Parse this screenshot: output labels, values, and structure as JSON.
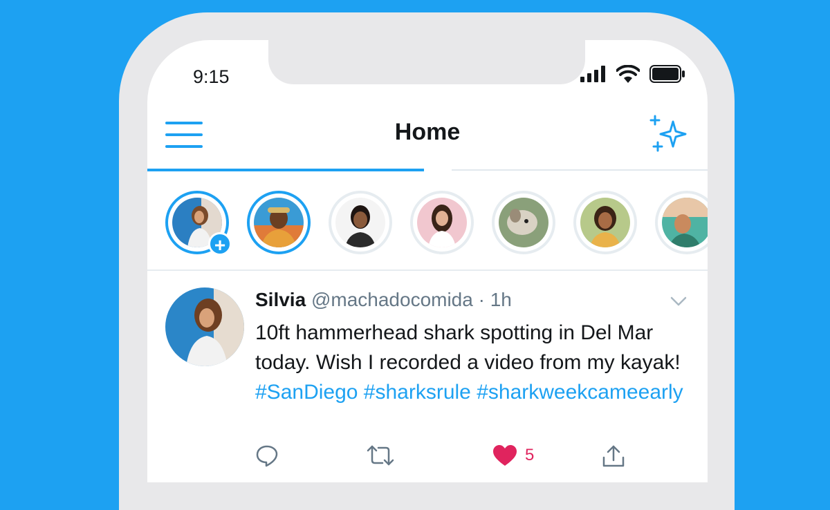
{
  "status_bar": {
    "time": "9:15",
    "icons": [
      "signal-icon",
      "wifi-icon",
      "battery-icon"
    ]
  },
  "header": {
    "title": "Home",
    "menu_icon": "hamburger-menu-icon",
    "action_icon": "sparkle-icon"
  },
  "fleets": {
    "items": [
      {
        "owner": "self",
        "state": "active",
        "has_add_badge": true,
        "add_badge": "+"
      },
      {
        "state": "active"
      },
      {
        "state": "seen"
      },
      {
        "state": "seen"
      },
      {
        "state": "seen"
      },
      {
        "state": "seen"
      },
      {
        "state": "seen"
      }
    ]
  },
  "tweet": {
    "name": "Silvia",
    "handle": "@machadocomida",
    "separator": "·",
    "time": "1h",
    "text_before": "10ft hammerhead shark spotting in Del Mar today. Wish I recorded a video from my kayak! ",
    "hashtags": [
      "#SanDiego",
      "#sharksrule",
      "#sharkweekcameearly"
    ],
    "actions": {
      "reply_icon": "reply-icon",
      "retweet_icon": "retweet-icon",
      "like_icon": "heart-icon",
      "like_count": "5",
      "share_icon": "share-icon"
    }
  },
  "colors": {
    "background": "#1da1f2",
    "accent": "#1da1f2",
    "like": "#e0245e",
    "text": "#14171a",
    "muted": "#657786"
  }
}
